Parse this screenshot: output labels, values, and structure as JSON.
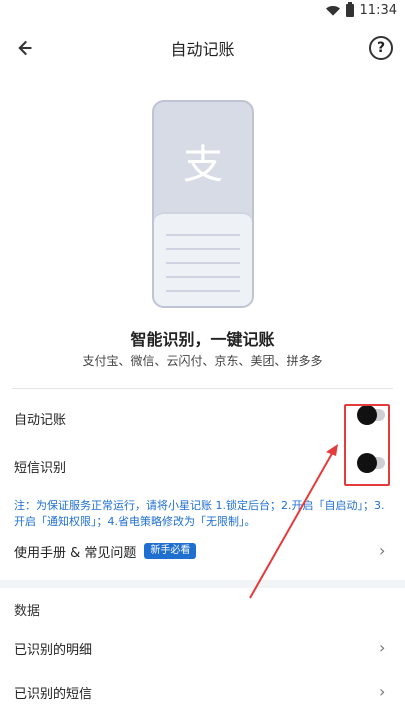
{
  "status": {
    "time": "11:34"
  },
  "app_bar": {
    "title": "自动记账"
  },
  "illustration": {
    "icon_char": "支"
  },
  "hero": {
    "headline": "智能识别，一键记账",
    "sources": "支付宝、微信、云闪付、京东、美团、拼多多"
  },
  "settings": {
    "auto_label": "自动记账",
    "auto_state": "off",
    "sms_label": "短信识别",
    "sms_state": "off",
    "note": "注：为保证服务正常运行，请将小星记账 1.锁定后台；2.开启「自启动」；3.开启「通知权限」；4.省电策略修改为「无限制」。",
    "manual_label": "使用手册 & 常见问题",
    "manual_badge": "新手必看"
  },
  "data_section": {
    "title": "数据",
    "items": [
      {
        "label": "已识别的明细"
      },
      {
        "label": "已识别的短信"
      }
    ]
  },
  "colors": {
    "accent": "#1f6fd1",
    "annotation": "#e43c3c"
  }
}
